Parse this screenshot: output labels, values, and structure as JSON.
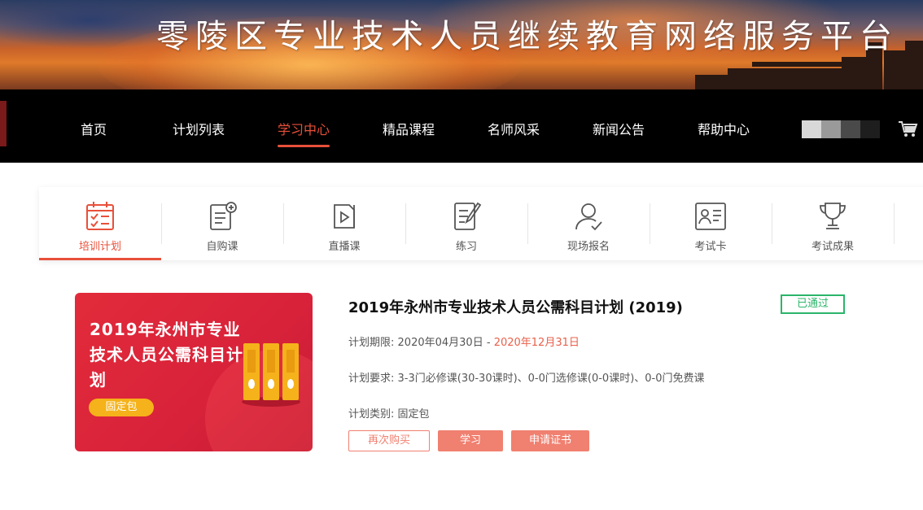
{
  "header": {
    "site_title": "零陵区专业技术人员继续教育网络服务平台"
  },
  "nav": {
    "items": [
      {
        "label": "首页"
      },
      {
        "label": "计划列表"
      },
      {
        "label": "学习中心",
        "active": true
      },
      {
        "label": "精品课程"
      },
      {
        "label": "名师风采"
      },
      {
        "label": "新闻公告"
      },
      {
        "label": "帮助中心"
      }
    ],
    "cart_icon": "shopping-cart-icon",
    "accent_color": "#e8503a"
  },
  "tabs": [
    {
      "label": "培训计划",
      "icon": "calendar-checklist-icon",
      "active": true
    },
    {
      "label": "自购课",
      "icon": "document-add-icon"
    },
    {
      "label": "直播课",
      "icon": "video-play-icon"
    },
    {
      "label": "练习",
      "icon": "notebook-pen-icon"
    },
    {
      "label": "现场报名",
      "icon": "user-check-icon"
    },
    {
      "label": "考试卡",
      "icon": "id-card-icon"
    },
    {
      "label": "考试成果",
      "icon": "trophy-icon"
    }
  ],
  "plan": {
    "cover": {
      "title": "2019年永州市专业技术人员公需科目计划",
      "tag": "固定包"
    },
    "title": "2019年永州市专业技术人员公需科目计划 (2019)",
    "status": "已通过",
    "status_color": "#2bb56a",
    "period_label": "计划期限:",
    "period_start": "2020年04月30日",
    "period_sep": "-",
    "period_end": "2020年12月31日",
    "requirement": "计划要求: 3-3门必修课(30-30课时)、0-0门选修课(0-0课时)、0-0门免费课",
    "category": "计划类别: 固定包",
    "buttons": {
      "rebuy": "再次购买",
      "study": "学习",
      "certificate": "申请证书"
    }
  }
}
